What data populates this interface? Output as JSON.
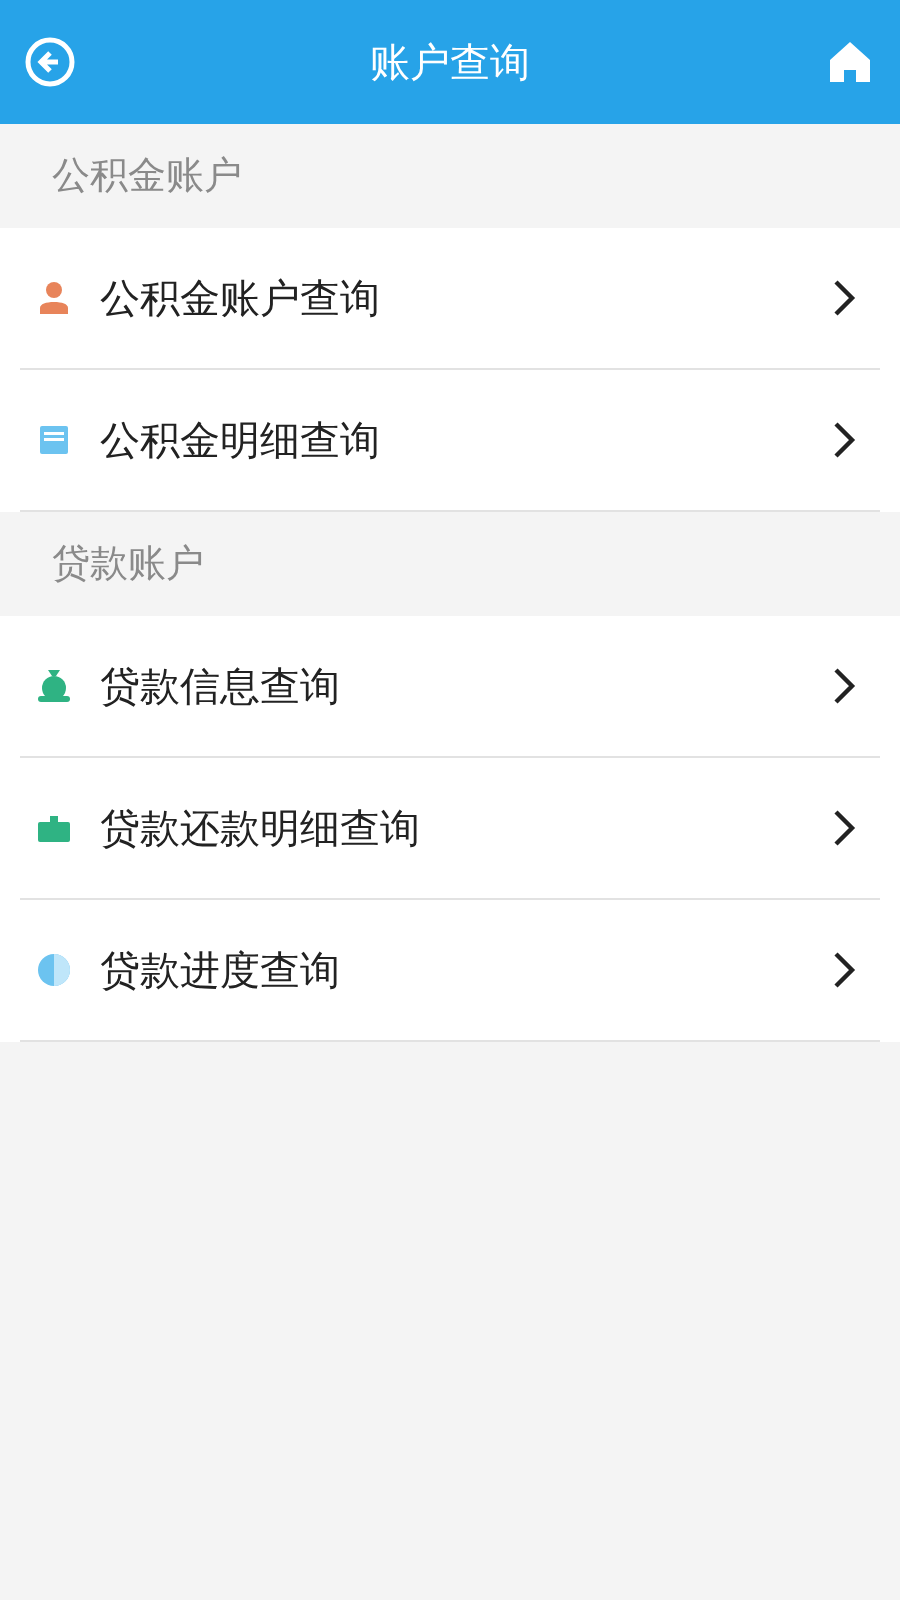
{
  "header": {
    "title": "账户查询"
  },
  "sections": [
    {
      "title": "公积金账户",
      "items": [
        {
          "label": "公积金账户查询"
        },
        {
          "label": "公积金明细查询"
        }
      ]
    },
    {
      "title": "贷款账户",
      "items": [
        {
          "label": "贷款信息查询"
        },
        {
          "label": "贷款还款明细查询"
        },
        {
          "label": "贷款进度查询"
        }
      ]
    }
  ]
}
